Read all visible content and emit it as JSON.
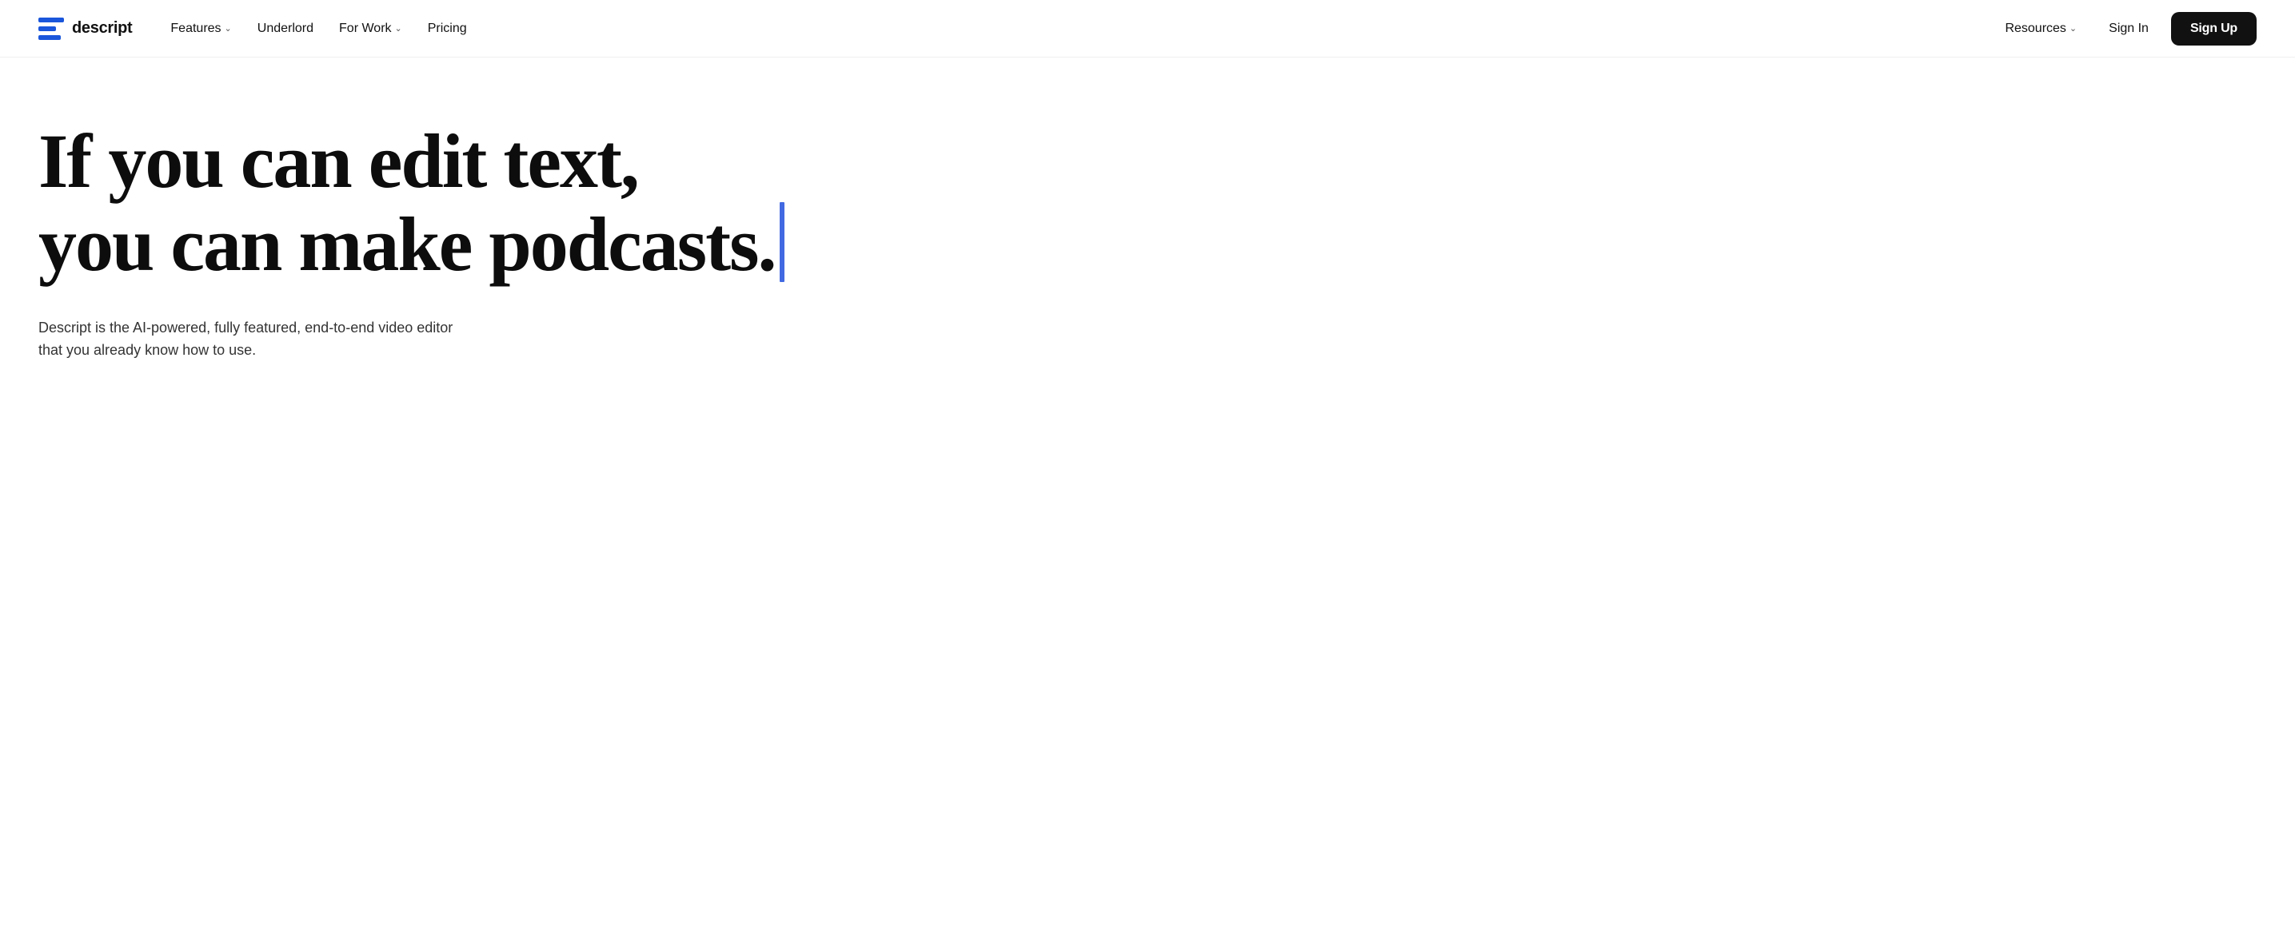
{
  "nav": {
    "logo_text": "descript",
    "links": [
      {
        "label": "Features",
        "has_chevron": true
      },
      {
        "label": "Underlord",
        "has_chevron": false
      },
      {
        "label": "For Work",
        "has_chevron": true
      },
      {
        "label": "Pricing",
        "has_chevron": false
      }
    ],
    "right_links": [
      {
        "label": "Resources",
        "has_chevron": true
      }
    ],
    "signin_label": "Sign In",
    "signup_label": "Sign Up"
  },
  "hero": {
    "headline_line1": "If you can edit text,",
    "headline_line2": "you can make podcasts.",
    "sub_line1": "Descript is the AI-powered, fully featured, end-to-end video editor",
    "sub_line2": "that you already know how to use.",
    "cursor_color": "#4169e1"
  }
}
